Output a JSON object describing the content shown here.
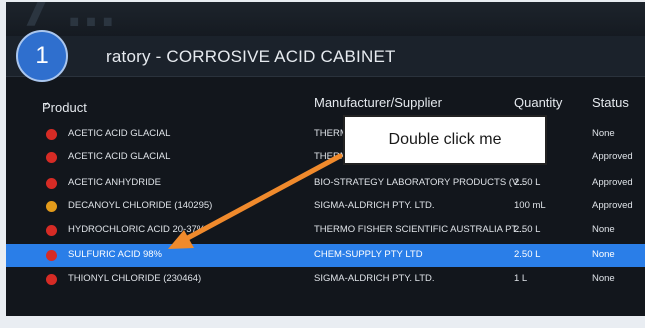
{
  "step": "1",
  "title": "ratory - CORROSIVE ACID CABINET",
  "columns": [
    "Product",
    "Manufacturer/Supplier",
    "Quantity",
    "Status"
  ],
  "sort_indicator": "^",
  "rows": [
    {
      "product": "ACETIC ACID GLACIAL",
      "supplier": "THERMO",
      "qty": "",
      "status": "None",
      "dot": "#d62b25"
    },
    {
      "product": "ACETIC ACID GLACIAL",
      "supplier": "THERM",
      "qty": "",
      "status": "Approved",
      "dot": "#d62b25"
    },
    {
      "product": "ACETIC ANHYDRIDE",
      "supplier": "BIO-STRATEGY LABORATORY PRODUCTS (V...",
      "qty": "2.50 L",
      "status": "Approved",
      "dot": "#d62b25"
    },
    {
      "product": "DECANOYL CHLORIDE (140295)",
      "supplier": "SIGMA-ALDRICH PTY. LTD.",
      "qty": "100 mL",
      "status": "Approved",
      "dot": "#e39b1b"
    },
    {
      "product": "HYDROCHLORIC ACID 20-37%",
      "supplier": "THERMO FISHER SCIENTIFIC AUSTRALIA PT...",
      "qty": "2.50 L",
      "status": "None",
      "dot": "#d62b25"
    },
    {
      "product": "SULFURIC ACID 98%",
      "supplier": "CHEM-SUPPLY PTY LTD",
      "qty": "2.50 L",
      "status": "None",
      "dot": "#d62b25"
    },
    {
      "product": "THIONYL CHLORIDE (230464)",
      "supplier": "SIGMA-ALDRICH PTY. LTD.",
      "qty": "1 L",
      "status": "None",
      "dot": "#d62b25"
    }
  ],
  "callout": "Double click me",
  "colors": {
    "selected_row": "#2a7ee8",
    "arrow": "#f08a2c"
  }
}
